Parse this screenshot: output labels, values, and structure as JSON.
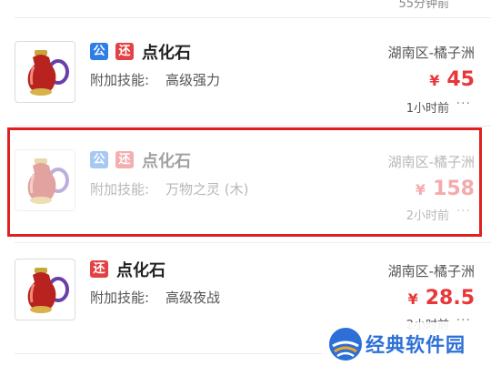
{
  "top_partial_time": "55分钟前",
  "listings": [
    {
      "badges": [
        "公",
        "还"
      ],
      "name": "点化石",
      "skill_label": "附加技能:",
      "skill_value": "高级强力",
      "server": "湖南区-橘子洲",
      "currency": "¥",
      "price": "45",
      "time": "1小时前",
      "more": "···",
      "faded": false
    },
    {
      "badges": [
        "公",
        "还"
      ],
      "name": "点化石",
      "skill_label": "附加技能:",
      "skill_value": "万物之灵 (木)",
      "server": "湖南区-橘子洲",
      "currency": "¥",
      "price": "158",
      "time": "2小时前",
      "more": "···",
      "faded": true,
      "highlighted": true
    },
    {
      "badges": [
        "还"
      ],
      "name": "点化石",
      "skill_label": "附加技能:",
      "skill_value": "高级夜战",
      "server": "湖南区-橘子洲",
      "currency": "¥",
      "price": "28.5",
      "time": "2小时前",
      "more": "···",
      "faded": false
    }
  ],
  "watermark": {
    "text": "经典软件园"
  },
  "colors": {
    "price_red": "#e8373a",
    "badge_blue": "#2f7ee6",
    "badge_red": "#e34244",
    "highlight_red": "#e02020",
    "watermark_blue": "#2c6fd6"
  },
  "icons": [
    "vase-item-icon",
    "more-icon",
    "watermark-logo-icon"
  ]
}
